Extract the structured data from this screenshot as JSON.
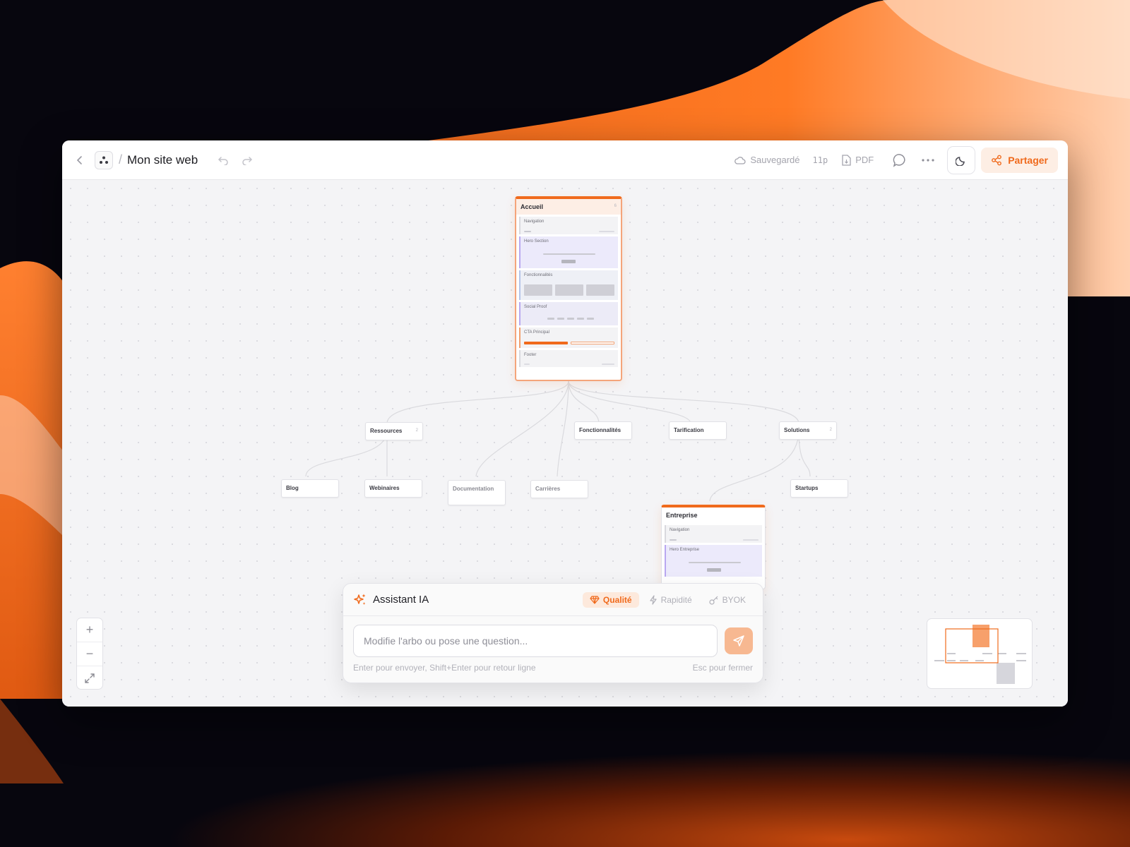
{
  "topbar": {
    "title": "Mon site web",
    "saved_label": "Sauvegardé",
    "pages_count": "11p",
    "pdf_label": "PDF",
    "share_label": "Partager"
  },
  "sitemap": {
    "home": {
      "title": "Accueil",
      "count": "6",
      "sections": [
        "Navigation",
        "Hero Section",
        "Fonctionnalités",
        "Social Proof",
        "CTA Principal",
        "Footer"
      ]
    },
    "level1": {
      "ressources": {
        "label": "Ressources",
        "count": "2"
      },
      "fonctionnalites": {
        "label": "Fonctionnalités"
      },
      "tarification": {
        "label": "Tarification"
      },
      "solutions": {
        "label": "Solutions",
        "count": "2"
      }
    },
    "level2": {
      "blog": "Blog",
      "webinaires": "Webinaires",
      "documentation": "Documentation",
      "carrieres": "Carrières",
      "startups": "Startups"
    },
    "entreprise": {
      "title": "Entreprise",
      "sections": [
        "Navigation",
        "Hero Entreprise"
      ]
    }
  },
  "assistant": {
    "title": "Assistant IA",
    "modes": [
      "Qualité",
      "Rapidité",
      "BYOK"
    ],
    "active_mode": "Qualité",
    "input_placeholder": "Modifie l'arbo ou pose une question...",
    "hint_send": "Enter pour envoyer, Shift+Enter pour retour ligne",
    "hint_close": "Esc pour fermer"
  },
  "zoom": {
    "in": "+",
    "out": "−"
  },
  "colors": {
    "accent": "#f06a1c",
    "accent_soft": "#fdeee4",
    "background_dark": "#07060e"
  }
}
